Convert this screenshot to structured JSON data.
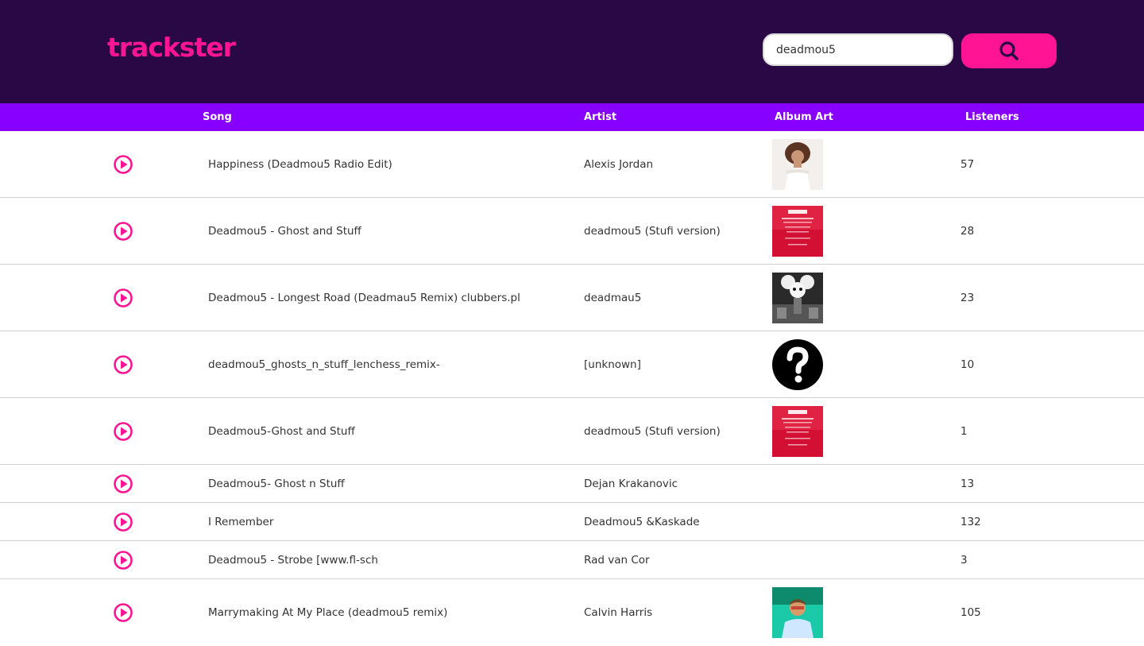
{
  "app": {
    "logo": "trackster"
  },
  "search": {
    "value": "deadmou5",
    "button_icon": "search-icon"
  },
  "columns": {
    "song": "Song",
    "artist": "Artist",
    "album_art": "Album Art",
    "listeners": "Listeners"
  },
  "colors": {
    "topbar": "#2a0845",
    "accent": "#ff1493",
    "header": "#8800ff"
  },
  "tracks": [
    {
      "song": "Happiness (Deadmou5 Radio Edit)",
      "artist": "Alexis Jordan",
      "listeners": "57",
      "art": "photo-woman"
    },
    {
      "song": "Deadmou5 - Ghost and Stuff",
      "artist": "deadmou5 (Stufi version)",
      "listeners": "28",
      "art": "lastfm-placeholder"
    },
    {
      "song": "Deadmou5 - Longest Road (Deadmau5 Remix) clubbers.pl",
      "artist": "deadmau5",
      "listeners": "23",
      "art": "bw-mouse-head"
    },
    {
      "song": "deadmou5_ghosts_n_stuff_lenchess_remix-",
      "artist": "[unknown]",
      "listeners": "10",
      "art": "question-mark"
    },
    {
      "song": "Deadmou5-Ghost and Stuff",
      "artist": "deadmou5 (Stufi version)",
      "listeners": "1",
      "art": "lastfm-placeholder"
    },
    {
      "song": "Deadmou5- Ghost n Stuff",
      "artist": "Dejan Krakanovic",
      "listeners": "13",
      "art": "none"
    },
    {
      "song": "I Remember",
      "artist": "Deadmou5 &Kaskade",
      "listeners": "132",
      "art": "none"
    },
    {
      "song": "Deadmou5 - Strobe [www.fl-sch",
      "artist": "Rad van Cor",
      "listeners": "3",
      "art": "none"
    },
    {
      "song": "Marrymaking At My Place (deadmou5 remix)",
      "artist": "Calvin Harris",
      "listeners": "105",
      "art": "photo-man"
    }
  ]
}
